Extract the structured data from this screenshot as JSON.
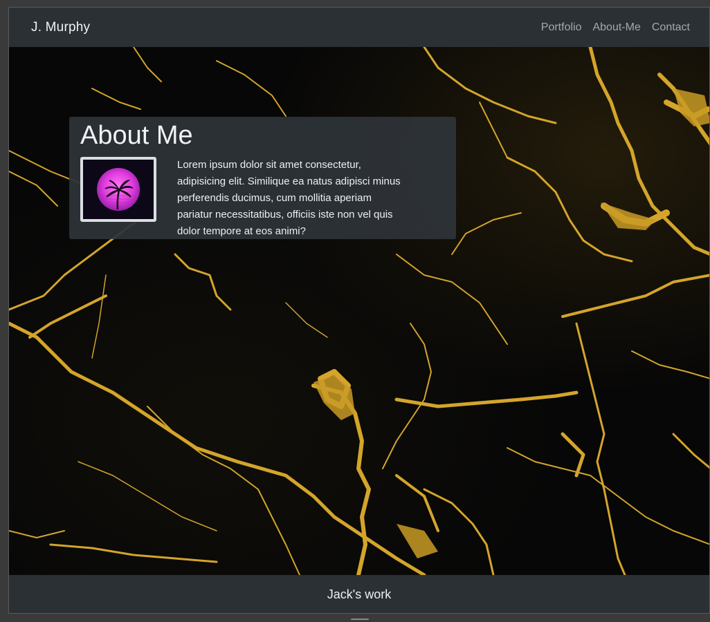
{
  "navbar": {
    "brand": "J. Murphy",
    "links": [
      "Portfolio",
      "About-Me",
      "Contact"
    ]
  },
  "about": {
    "title": "About Me",
    "text": "Lorem ipsum dolor sit amet consectetur, adipisicing elit. Similique ea natus adipisci minus perferendis ducimus, cum mollitia aperiam pariatur necessitatibus, officiis iste non vel quis dolor tempore at eos animi?"
  },
  "footer": {
    "text": "Jack's work"
  },
  "colors": {
    "bar": "#2b3035",
    "card": "#2e3338",
    "marble_gold": "#d4a52a",
    "avatar_magenta": "#e33de0"
  },
  "icons": {
    "avatar": "palm-tree-sunset-icon"
  }
}
